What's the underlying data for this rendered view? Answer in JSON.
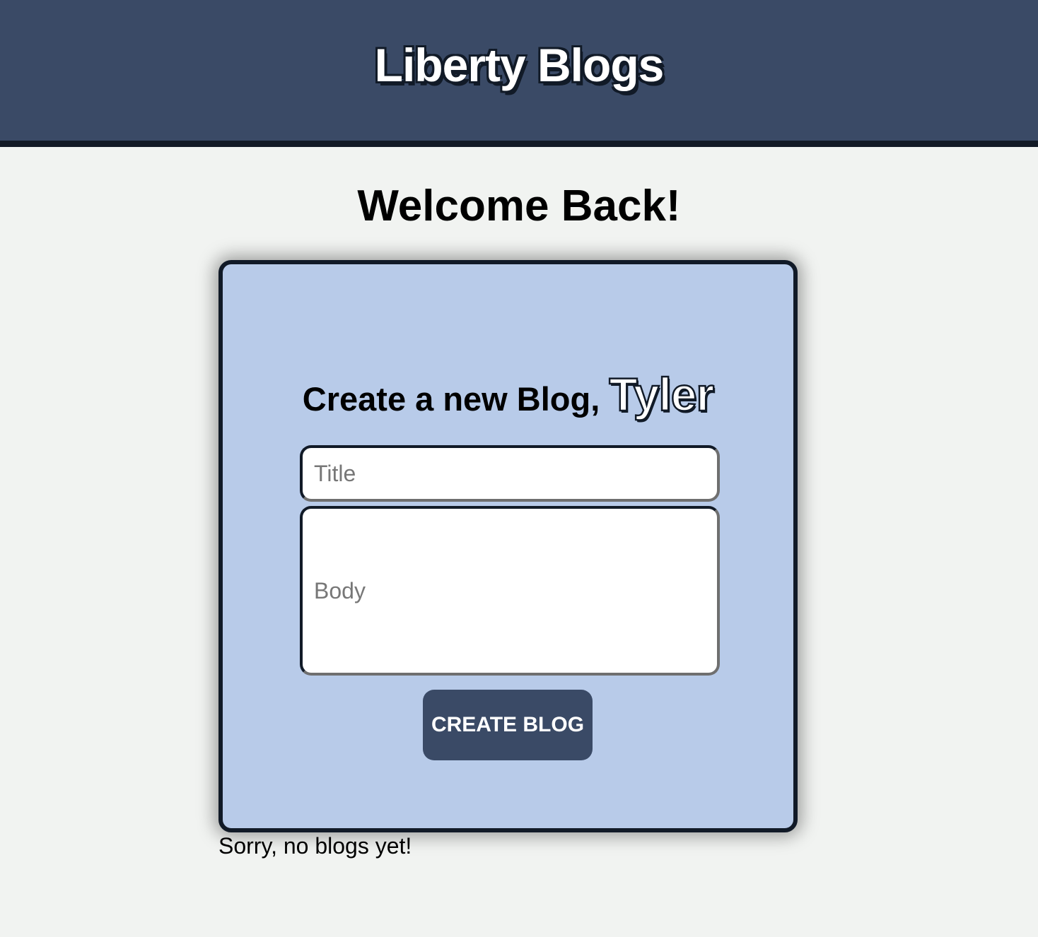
{
  "header": {
    "title": "Liberty Blogs"
  },
  "main": {
    "welcome": "Welcome Back!",
    "form": {
      "heading": "Create a new Blog,",
      "username": "Tyler",
      "title_placeholder": "Title",
      "body_placeholder": "Body",
      "submit_label": "CREATE BLOG"
    },
    "empty_message": "Sorry, no blogs yet!"
  },
  "colors": {
    "header_bg": "#3a4a66",
    "card_bg": "#b8cbe9",
    "page_bg": "#f1f3f1",
    "button_bg": "#3a4a66"
  }
}
